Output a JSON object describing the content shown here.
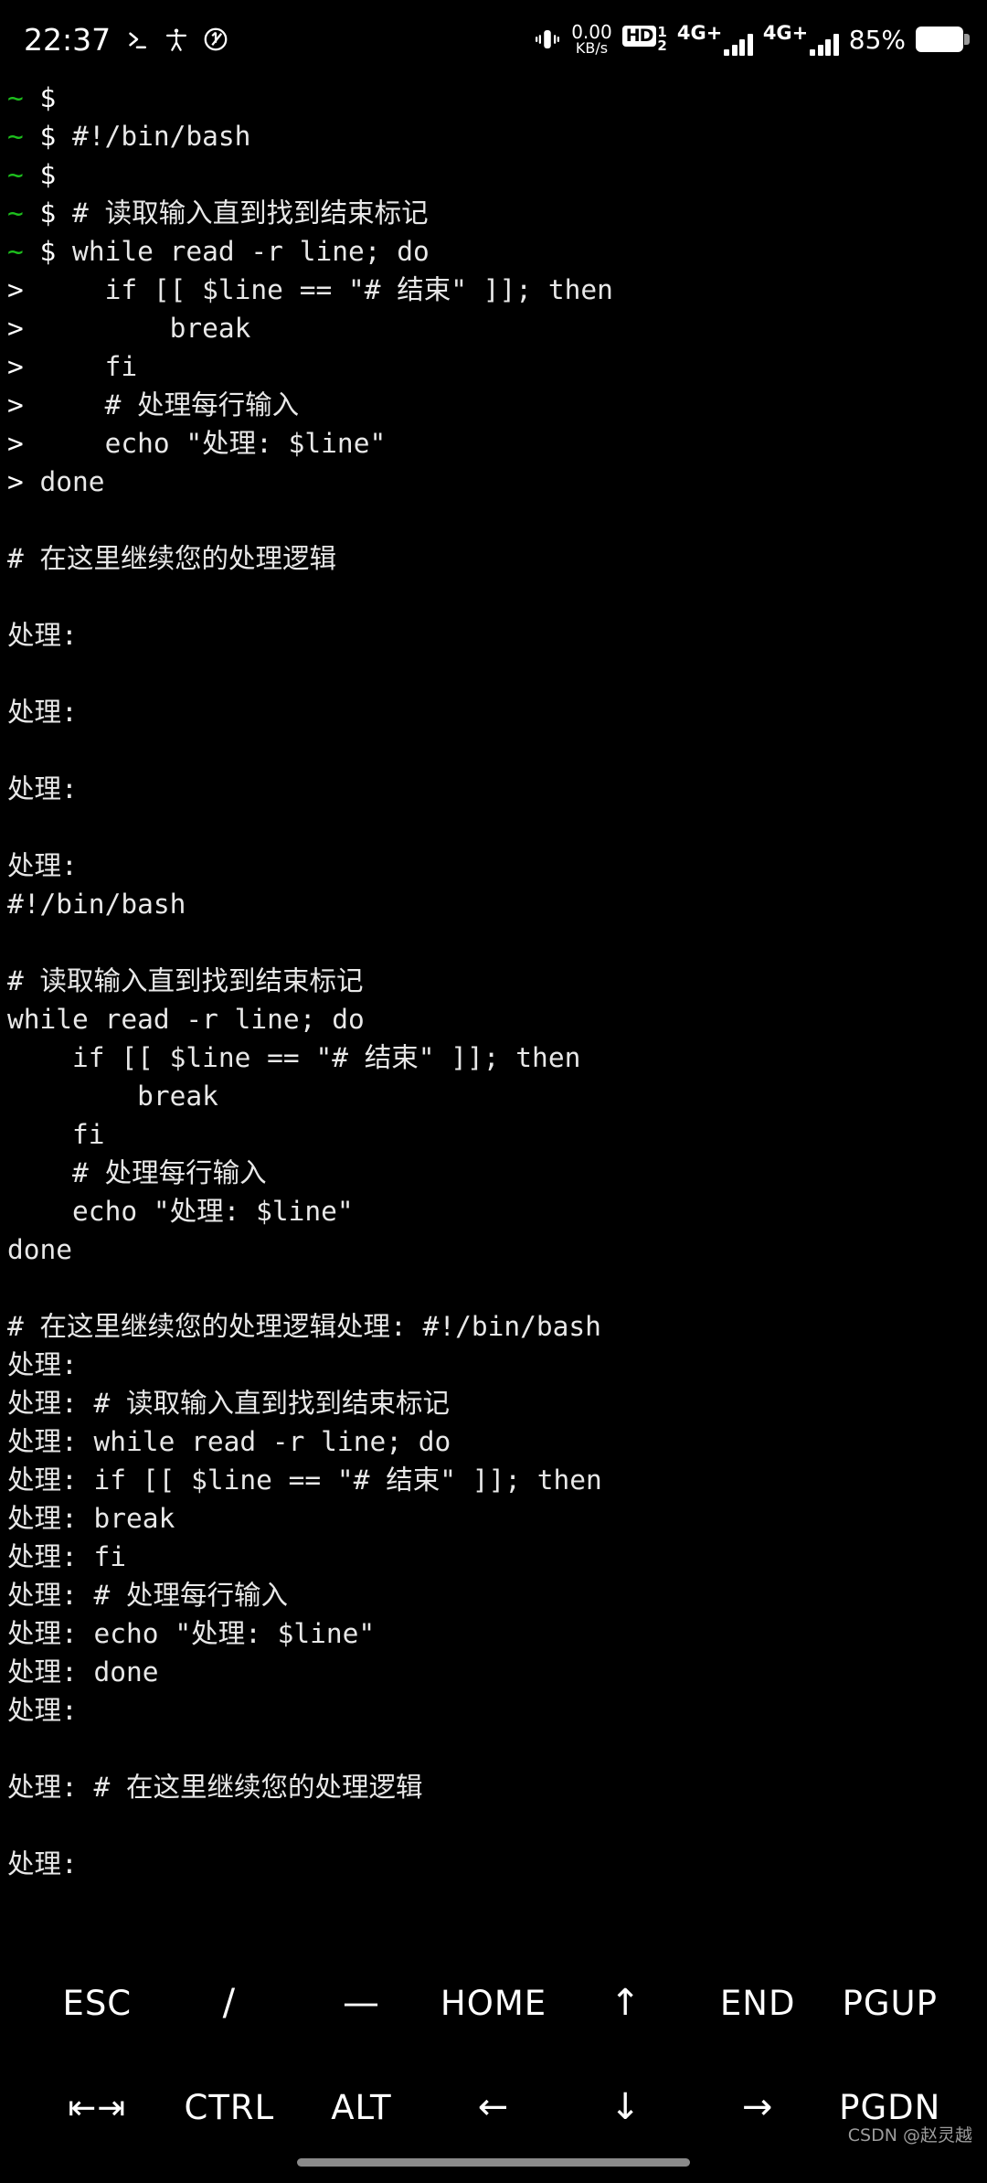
{
  "statusbar": {
    "time": "22:37",
    "terminal_icon": ">_",
    "accessibility_icon": "accessibility-icon",
    "dnd_icon": "vibrate-mode-icon",
    "net_rate_value": "0.00",
    "net_rate_unit": "KB/s",
    "hd_label": "HD",
    "hd_sup": "1",
    "hd_sub": "2",
    "sim1_label": "4G+",
    "sim2_label": "4G+",
    "battery_percent": "85%"
  },
  "terminal": {
    "lines": [
      {
        "type": "prompt",
        "tilde": "~",
        "prompt": "$",
        "text": ""
      },
      {
        "type": "prompt",
        "tilde": "~",
        "prompt": "$",
        "text": " #!/bin/bash"
      },
      {
        "type": "prompt",
        "tilde": "~",
        "prompt": "$",
        "text": ""
      },
      {
        "type": "prompt",
        "tilde": "~",
        "prompt": "$",
        "text": " # 读取输入直到找到结束标记"
      },
      {
        "type": "prompt",
        "tilde": "~",
        "prompt": "$",
        "text": " while read -r line; do"
      },
      {
        "type": "cont",
        "prompt": ">",
        "text": "     if [[ $line == \"# 结束\" ]]; then"
      },
      {
        "type": "cont",
        "prompt": ">",
        "text": "         break"
      },
      {
        "type": "cont",
        "prompt": ">",
        "text": "     fi"
      },
      {
        "type": "cont",
        "prompt": ">",
        "text": "     # 处理每行输入"
      },
      {
        "type": "cont",
        "prompt": ">",
        "text": "     echo \"处理: $line\""
      },
      {
        "type": "cont",
        "prompt": ">",
        "text": " done"
      },
      {
        "type": "blank",
        "text": ""
      },
      {
        "type": "out",
        "text": "# 在这里继续您的处理逻辑"
      },
      {
        "type": "blank",
        "text": ""
      },
      {
        "type": "out",
        "text": "处理:"
      },
      {
        "type": "blank",
        "text": ""
      },
      {
        "type": "out",
        "text": "处理:"
      },
      {
        "type": "blank",
        "text": ""
      },
      {
        "type": "out",
        "text": "处理:"
      },
      {
        "type": "blank",
        "text": ""
      },
      {
        "type": "out",
        "text": "处理:"
      },
      {
        "type": "out",
        "text": "#!/bin/bash"
      },
      {
        "type": "blank",
        "text": ""
      },
      {
        "type": "out",
        "text": "# 读取输入直到找到结束标记"
      },
      {
        "type": "out",
        "text": "while read -r line; do"
      },
      {
        "type": "out",
        "text": "    if [[ $line == \"# 结束\" ]]; then"
      },
      {
        "type": "out",
        "text": "        break"
      },
      {
        "type": "out",
        "text": "    fi"
      },
      {
        "type": "out",
        "text": "    # 处理每行输入"
      },
      {
        "type": "out",
        "text": "    echo \"处理: $line\""
      },
      {
        "type": "out",
        "text": "done"
      },
      {
        "type": "blank",
        "text": ""
      },
      {
        "type": "out",
        "text": "# 在这里继续您的处理逻辑处理: #!/bin/bash"
      },
      {
        "type": "out",
        "text": "处理:"
      },
      {
        "type": "out",
        "text": "处理: # 读取输入直到找到结束标记"
      },
      {
        "type": "out",
        "text": "处理: while read -r line; do"
      },
      {
        "type": "out",
        "text": "处理: if [[ $line == \"# 结束\" ]]; then"
      },
      {
        "type": "out",
        "text": "处理: break"
      },
      {
        "type": "out",
        "text": "处理: fi"
      },
      {
        "type": "out",
        "text": "处理: # 处理每行输入"
      },
      {
        "type": "out",
        "text": "处理: echo \"处理: $line\""
      },
      {
        "type": "out",
        "text": "处理: done"
      },
      {
        "type": "out",
        "text": "处理:"
      },
      {
        "type": "blank",
        "text": ""
      },
      {
        "type": "out",
        "text": "处理: # 在这里继续您的处理逻辑"
      },
      {
        "type": "blank",
        "text": ""
      },
      {
        "type": "out",
        "text": "处理:"
      }
    ]
  },
  "keyboard": {
    "row1": [
      {
        "name": "esc",
        "label": "ESC"
      },
      {
        "name": "slash",
        "label": "/"
      },
      {
        "name": "dash",
        "label": "—"
      },
      {
        "name": "home",
        "label": "HOME"
      },
      {
        "name": "arrow-up",
        "label": "↑"
      },
      {
        "name": "end",
        "label": "END"
      },
      {
        "name": "pgup",
        "label": "PGUP"
      }
    ],
    "row2": [
      {
        "name": "tab",
        "label": "⇤⇥"
      },
      {
        "name": "ctrl",
        "label": "CTRL"
      },
      {
        "name": "alt",
        "label": "ALT"
      },
      {
        "name": "arrow-left",
        "label": "←"
      },
      {
        "name": "arrow-down",
        "label": "↓"
      },
      {
        "name": "arrow-right",
        "label": "→"
      },
      {
        "name": "pgdn",
        "label": "PGDN"
      }
    ]
  },
  "watermark": "CSDN @赵灵越"
}
